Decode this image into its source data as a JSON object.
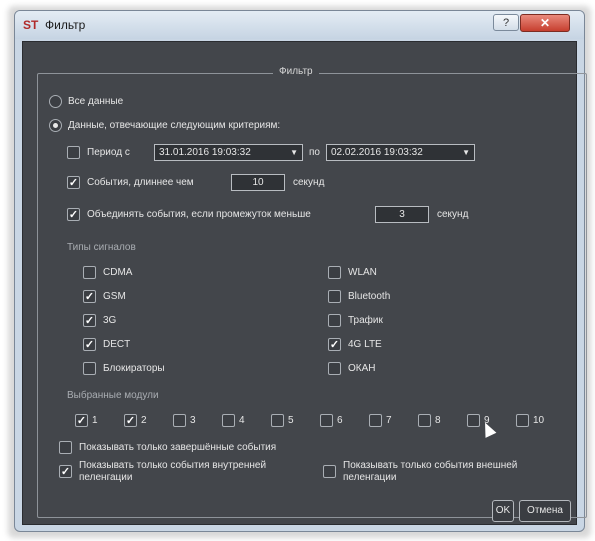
{
  "window": {
    "title": "Фильтр",
    "app_icon": "ST",
    "help_glyph": "?",
    "close_glyph": "✕"
  },
  "group": {
    "title": "Фильтр"
  },
  "mode": {
    "all_data_label": "Все данные",
    "criteria_label": "Данные, отвечающие следующим критериям:",
    "selected": "criteria"
  },
  "period": {
    "label": "Период с",
    "checked": false,
    "from": "31.01.2016 19:03:32",
    "to_label": "по",
    "to": "02.02.2016 19:03:32"
  },
  "longer": {
    "label": "События, длиннее чем",
    "checked": true,
    "value": "10",
    "unit": "секунд"
  },
  "merge": {
    "label": "Объединять события, если промежуток меньше",
    "checked": true,
    "value": "3",
    "unit": "секунд"
  },
  "signal_types": {
    "header": "Типы сигналов",
    "left": [
      {
        "label": "CDMA",
        "checked": false
      },
      {
        "label": "GSM",
        "checked": true
      },
      {
        "label": "3G",
        "checked": true
      },
      {
        "label": "DECT",
        "checked": true
      },
      {
        "label": "Блокираторы",
        "checked": false
      }
    ],
    "right": [
      {
        "label": "WLAN",
        "checked": false
      },
      {
        "label": "Bluetooth",
        "checked": false
      },
      {
        "label": "Трафик",
        "checked": false
      },
      {
        "label": "4G LTE",
        "checked": true
      },
      {
        "label": "ОКАН",
        "checked": false
      }
    ]
  },
  "modules": {
    "header": "Выбранные модули",
    "items": [
      {
        "label": "1",
        "checked": true
      },
      {
        "label": "2",
        "checked": true
      },
      {
        "label": "3",
        "checked": false
      },
      {
        "label": "4",
        "checked": false
      },
      {
        "label": "5",
        "checked": false
      },
      {
        "label": "6",
        "checked": false
      },
      {
        "label": "7",
        "checked": false
      },
      {
        "label": "8",
        "checked": false
      },
      {
        "label": "9",
        "checked": false
      },
      {
        "label": "10",
        "checked": false
      }
    ]
  },
  "options": {
    "completed_only": {
      "label": "Показывать только завершённые события",
      "checked": false
    },
    "internal": {
      "label_line1": "Показывать только события внутренней",
      "label_line2": "пеленгации",
      "checked": true
    },
    "external": {
      "label_line1": "Показывать только события внешней",
      "label_line2": "пеленгации",
      "checked": false
    }
  },
  "buttons": {
    "ok": "OK",
    "cancel": "Отмена"
  },
  "check_glyph": "✓"
}
